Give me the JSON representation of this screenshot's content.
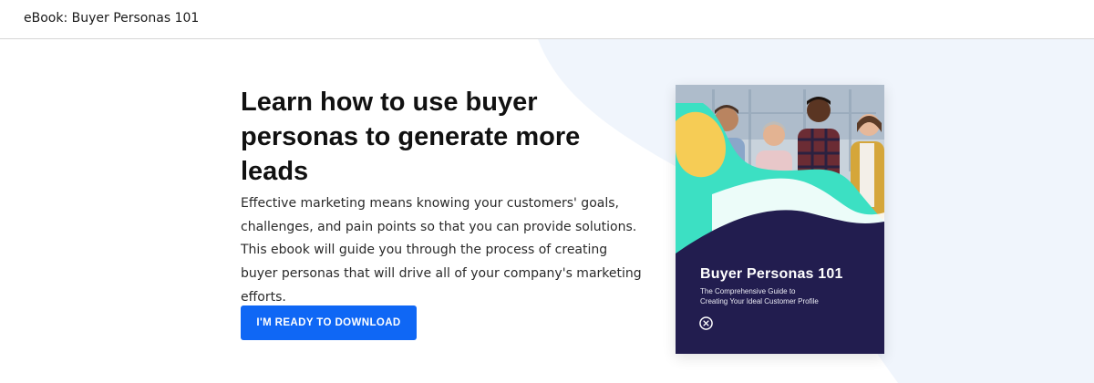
{
  "header": {
    "title": "eBook: Buyer Personas 101"
  },
  "hero": {
    "heading": "Learn how to use buyer personas to generate more leads",
    "body": "Effective marketing means knowing your customers' goals, challenges, and pain points so that you can provide solutions. This ebook will guide you through the process of creating buyer personas that will drive all of your company's marketing efforts.",
    "cta_label": "I'M READY TO DOWNLOAD"
  },
  "ebook_cover": {
    "title": "Buyer Personas 101",
    "subtitle_line1": "The Comprehensive Guide to",
    "subtitle_line2": "Creating Your Ideal Customer Profile",
    "logo_icon": "brand-logo-icon"
  },
  "colors": {
    "accent": "#0f67f5",
    "cover_navy": "#221d4f",
    "cover_teal": "#3ce0c3",
    "cover_yellow": "#f6cc55",
    "background_shape": "#f0f5fc"
  }
}
